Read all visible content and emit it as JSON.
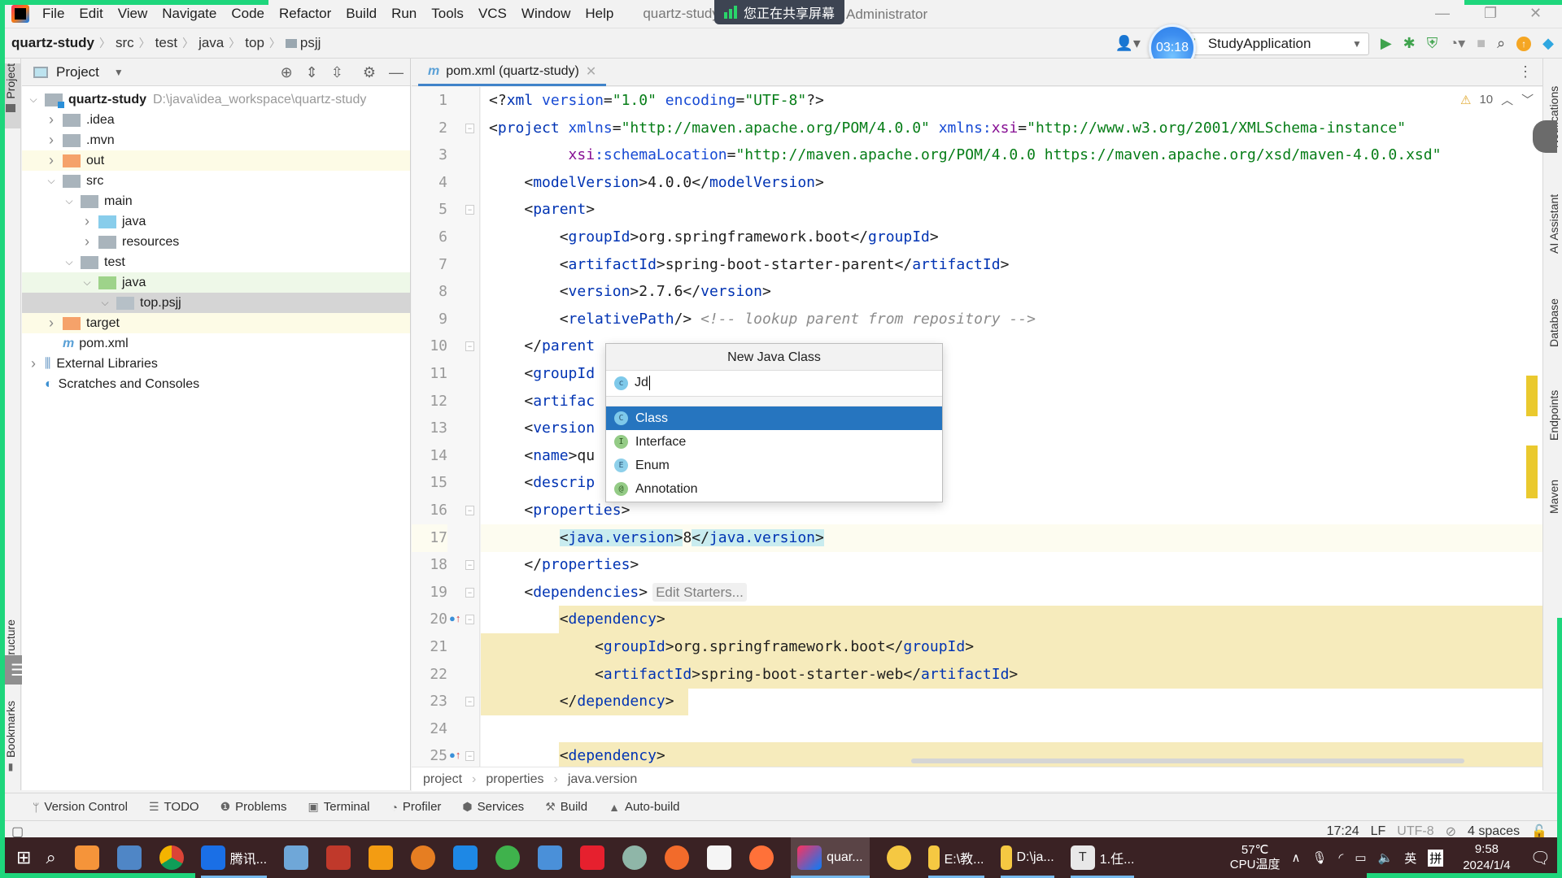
{
  "menubar": {
    "items": [
      {
        "label": "File",
        "u": "F"
      },
      {
        "label": "Edit",
        "u": "E"
      },
      {
        "label": "View",
        "u": "V"
      },
      {
        "label": "Navigate",
        "u": "N"
      },
      {
        "label": "Code",
        "u": "C"
      },
      {
        "label": "Refactor",
        "u": "R"
      },
      {
        "label": "Build",
        "u": "B"
      },
      {
        "label": "Run",
        "u": "u"
      },
      {
        "label": "Tools",
        "u": "T"
      },
      {
        "label": "VCS",
        "u": "S"
      },
      {
        "label": "Window",
        "u": "W"
      },
      {
        "label": "Help",
        "u": "H"
      }
    ],
    "window_title": "quartz-study - pom",
    "user": "Administrator",
    "share_notice": "您正在共享屏幕"
  },
  "navbar": {
    "breadcrumb": [
      "quartz-study",
      "src",
      "test",
      "java",
      "top",
      "psjj"
    ],
    "run_config": "StudyApplication",
    "timer": "03:18"
  },
  "project_panel": {
    "title": "Project",
    "tree": [
      {
        "label": "quartz-study",
        "path": "D:\\java\\idea_workspace\\quartz-study",
        "depth": 0,
        "expanded": true,
        "icon": "module",
        "bold": true
      },
      {
        "label": ".idea",
        "depth": 1,
        "expanded": false,
        "icon": "gray"
      },
      {
        "label": ".mvn",
        "depth": 1,
        "expanded": false,
        "icon": "gray"
      },
      {
        "label": "out",
        "depth": 1,
        "expanded": false,
        "icon": "orange",
        "hl": "yellow"
      },
      {
        "label": "src",
        "depth": 1,
        "expanded": true,
        "icon": "gray"
      },
      {
        "label": "main",
        "depth": 2,
        "expanded": true,
        "icon": "gray"
      },
      {
        "label": "java",
        "depth": 3,
        "expanded": false,
        "icon": "blue"
      },
      {
        "label": "resources",
        "depth": 3,
        "expanded": false,
        "icon": "res"
      },
      {
        "label": "test",
        "depth": 2,
        "expanded": true,
        "icon": "gray"
      },
      {
        "label": "java",
        "depth": 3,
        "expanded": true,
        "icon": "green",
        "hl": "green"
      },
      {
        "label": "top.psjj",
        "depth": 4,
        "expanded": true,
        "icon": "pkg",
        "hl": "selected"
      },
      {
        "label": "target",
        "depth": 1,
        "expanded": false,
        "icon": "orange",
        "hl": "yellow"
      },
      {
        "label": "pom.xml",
        "depth": 1,
        "icon": "xml"
      },
      {
        "label": "External Libraries",
        "depth": 0,
        "expanded": false,
        "icon": "lib"
      },
      {
        "label": "Scratches and Consoles",
        "depth": 0,
        "icon": "scratch"
      }
    ]
  },
  "editor": {
    "tab": "pom.xml (quartz-study)",
    "warnings": "10",
    "lines": [
      {
        "n": 1,
        "html": "<span class='p'>&lt;?</span><span class='t'>xml </span><span class='a'>version</span><span class='p'>=</span><span class='v'>\"1.0\"</span> <span class='a'>encoding</span><span class='p'>=</span><span class='v'>\"UTF-8\"</span><span class='p'>?&gt;</span>"
      },
      {
        "n": 2,
        "html": "<span class='p'>&lt;</span><span class='t'>project </span><span class='a'>xmlns</span><span class='p'>=</span><span class='v'>\"http://maven.apache.org/POM/4.0.0\"</span> <span class='a'>xmlns:</span><span class='ns'>xsi</span><span class='p'>=</span><span class='v'>\"http://www.w3.org/2001/XMLSchema-instance\"</span>"
      },
      {
        "n": 3,
        "html": "         <span class='ns'>xsi</span><span class='a'>:schemaLocation</span><span class='p'>=</span><span class='v'>\"http://maven.apache.org/POM/4.0.0 https://maven.apache.org/xsd/maven-4.0.0.xsd\"</span>"
      },
      {
        "n": 4,
        "html": "    <span class='p'>&lt;</span><span class='t'>modelVersion</span><span class='p'>&gt;4.0.0&lt;/</span><span class='t'>modelVersion</span><span class='p'>&gt;</span>"
      },
      {
        "n": 5,
        "html": "    <span class='p'>&lt;</span><span class='t'>parent</span><span class='p'>&gt;</span>"
      },
      {
        "n": 6,
        "html": "        <span class='p'>&lt;</span><span class='t'>groupId</span><span class='p'>&gt;org.springframework.boot&lt;/</span><span class='t'>groupId</span><span class='p'>&gt;</span>"
      },
      {
        "n": 7,
        "html": "        <span class='p'>&lt;</span><span class='t'>artifactId</span><span class='p'>&gt;spring-boot-starter-parent&lt;/</span><span class='t'>artifactId</span><span class='p'>&gt;</span>"
      },
      {
        "n": 8,
        "html": "        <span class='p'>&lt;</span><span class='t'>version</span><span class='p'>&gt;2.7.6&lt;/</span><span class='t'>version</span><span class='p'>&gt;</span>"
      },
      {
        "n": 9,
        "html": "        <span class='p'>&lt;</span><span class='t'>relativePath</span><span class='p'>/&gt;</span> <span class='c'>&lt;!-- lookup parent from repository --&gt;</span>"
      },
      {
        "n": 10,
        "html": "    <span class='p'>&lt;/</span><span class='t'>parent</span>"
      },
      {
        "n": 11,
        "html": "    <span class='p'>&lt;</span><span class='t'>groupId</span>"
      },
      {
        "n": 12,
        "html": "    <span class='p'>&lt;</span><span class='t'>artifac</span>"
      },
      {
        "n": 13,
        "html": "    <span class='p'>&lt;</span><span class='t'>version</span>"
      },
      {
        "n": 14,
        "html": "    <span class='p'>&lt;</span><span class='t'>name</span><span class='p'>&gt;qu</span>"
      },
      {
        "n": 15,
        "html": "    <span class='p'>&lt;</span><span class='t'>descrip</span>"
      },
      {
        "n": 16,
        "html": "    <span class='p'>&lt;</span><span class='t'>properties</span><span class='p'>&gt;</span>"
      },
      {
        "n": 17,
        "html": "        <span class='tag-hl'><span class='p'>&lt;</span><span class='t'>java.version</span><span class='p'>&gt;</span></span><span class='p'>8</span><span class='tag-hl'><span class='p'>&lt;/</span><span class='t'>java.version</span><span class='p'>&gt;</span></span>",
        "current": true
      },
      {
        "n": 18,
        "html": "    <span class='p'>&lt;/</span><span class='t'>properties</span><span class='p'>&gt;</span>"
      },
      {
        "n": 19,
        "html": "    <span class='p'>&lt;</span><span class='t'>dependencies</span><span class='p'>&gt;</span><span class='inlay'>Edit Starters...</span>"
      },
      {
        "n": 20,
        "html": "        <span class='dep-hl'><span class='p'>&lt;</span><span class='t'>dependency</span><span class='p'>&gt;</span></span>",
        "dep": "partial"
      },
      {
        "n": 21,
        "html": "            <span class='p'>&lt;</span><span class='t'>groupId</span><span class='p'>&gt;org.springframework.boot&lt;/</span><span class='t'>groupId</span><span class='p'>&gt;</span>",
        "dep": "full"
      },
      {
        "n": 22,
        "html": "            <span class='p'>&lt;</span><span class='t'>artifactId</span><span class='p'>&gt;spring-boot-starter-web&lt;/</span><span class='t'>artifactId</span><span class='p'>&gt;</span>",
        "dep": "full"
      },
      {
        "n": 23,
        "html": "        <span class='dep-hl'><span class='p'>&lt;/</span><span class='t'>dependency</span><span class='p'>&gt;</span></span>",
        "dep": "full-left"
      },
      {
        "n": 24,
        "html": ""
      },
      {
        "n": 25,
        "html": "        <span class='dep-hl'><span class='p'>&lt;</span><span class='t'>dependency</span><span class='p'>&gt;</span></span>",
        "dep": "partial"
      }
    ],
    "breadcrumb": [
      "project",
      "properties",
      "java.version"
    ]
  },
  "popup": {
    "title": "New Java Class",
    "input_value": "Jd",
    "options": [
      {
        "label": "Class",
        "badge": "C",
        "kind": "c",
        "selected": true
      },
      {
        "label": "Interface",
        "badge": "I",
        "kind": "i"
      },
      {
        "label": "Enum",
        "badge": "E",
        "kind": "e"
      },
      {
        "label": "Annotation",
        "badge": "@",
        "kind": "a"
      }
    ]
  },
  "left_stripe": {
    "project": "Project",
    "structure": "Structure",
    "bookmarks": "Bookmarks"
  },
  "right_stripe": {
    "notifications": "Notifications",
    "ai": "AI Assistant",
    "database": "Database",
    "endpoints": "Endpoints",
    "maven": "Maven"
  },
  "toolwindows": [
    {
      "label": "Version Control",
      "icon": "ᛘ"
    },
    {
      "label": "TODO",
      "icon": "☰"
    },
    {
      "label": "Problems",
      "icon": "❶"
    },
    {
      "label": "Terminal",
      "icon": "▣"
    },
    {
      "label": "Profiler",
      "icon": "◔"
    },
    {
      "label": "Services",
      "icon": "⬢"
    },
    {
      "label": "Build",
      "icon": "⚒"
    },
    {
      "label": "Auto-build",
      "icon": "▲"
    }
  ],
  "statusbar": {
    "position": "17:24",
    "line_sep": "LF",
    "encoding": "UTF-8",
    "indent": "4 spaces"
  },
  "taskbar": {
    "apps": [
      {
        "label": "腾讯...",
        "color": "#1a6fe6"
      },
      {
        "label": "quar...",
        "color": "#1b1b1b",
        "active": true
      },
      {
        "label": "E:\\教...",
        "color": "#f5c842"
      },
      {
        "label": "D:\\ja...",
        "color": "#f5c842"
      },
      {
        "label": "1.任...",
        "color": "#e8e8e8"
      }
    ],
    "cpu_temp": "57℃",
    "cpu_label": "CPU温度",
    "ime1": "英",
    "ime2": "拼",
    "time": "9:58",
    "date": "2024/1/4"
  }
}
